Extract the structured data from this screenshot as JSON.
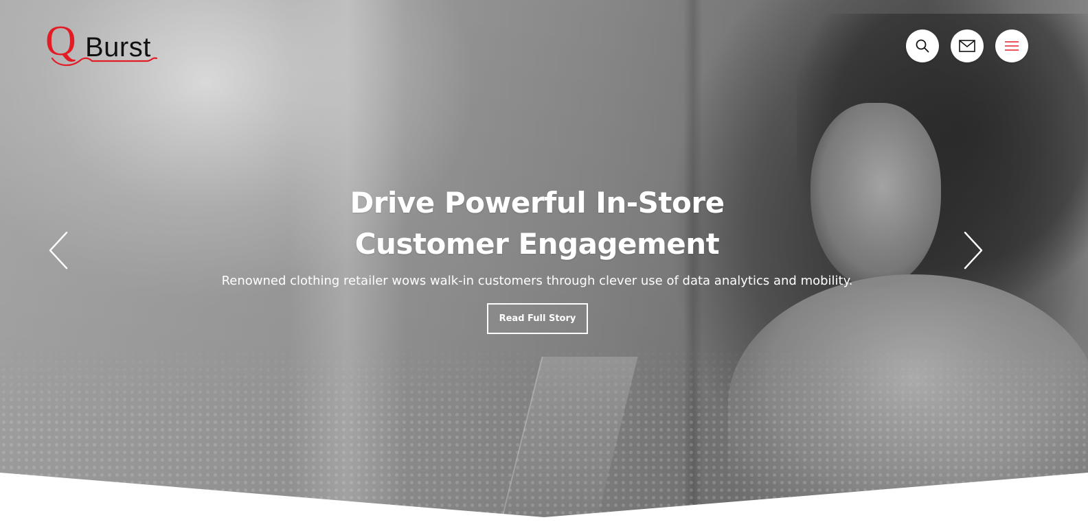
{
  "header": {
    "logo": {
      "q_letter": "Q",
      "wordmark": "Burst",
      "accent_color": "#e21b24"
    },
    "actions": {
      "search_icon": "search-icon",
      "mail_icon": "mail-icon",
      "menu_icon": "hamburger-menu-icon"
    }
  },
  "hero": {
    "headline_line1": "Drive Powerful In-Store",
    "headline_line2": "Customer Engagement",
    "subtitle": "Renowned clothing retailer wows walk-in customers through clever use of data analytics and mobility.",
    "cta_label": "Read Full Story",
    "prev_icon": "chevron-left-icon",
    "next_icon": "chevron-right-icon"
  },
  "colors": {
    "accent": "#e21b24",
    "text_on_hero": "#ffffff",
    "page_bg": "#ffffff"
  }
}
